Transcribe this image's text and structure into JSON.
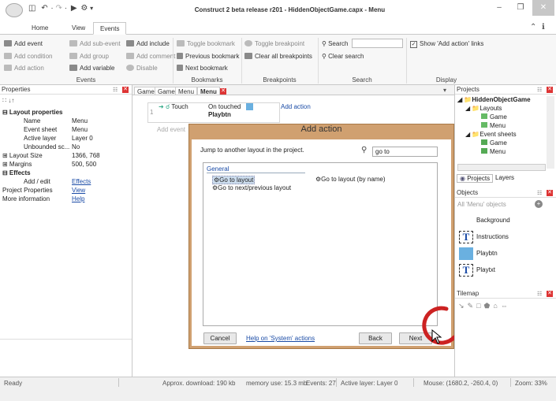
{
  "window": {
    "title": "Construct 2 beta release r201 - HiddenObjectGame.capx - Menu",
    "controls": {
      "minimize": "–",
      "restore": "❐",
      "close": "✕"
    }
  },
  "quick_access": {
    "icons": [
      "save-icon",
      "undo-icon",
      "redo-icon",
      "preview-icon",
      "debug-icon"
    ],
    "sep": "·",
    "arrow": "▾"
  },
  "menu_tabs": [
    "Home",
    "View",
    "Events"
  ],
  "ribbon_right_icons": {
    "collapse": "⌃",
    "help": "ℹ"
  },
  "ribbon": {
    "events": [
      "Add event",
      "Add sub-event",
      "Add include",
      "Add condition",
      "Add group",
      "Add comment",
      "Add action",
      "Add variable",
      "Disable"
    ],
    "bookmarks": [
      "Toggle bookmark",
      "Previous bookmark",
      "Next bookmark"
    ],
    "breakpoints": [
      "Toggle breakpoint",
      "Clear all breakpoints"
    ],
    "search": [
      "Search",
      "Clear search"
    ],
    "display": "Show 'Add action' links",
    "groups": [
      "Events",
      "Bookmarks",
      "Breakpoints",
      "Search",
      "Display"
    ]
  },
  "properties": {
    "title": "Properties",
    "toolbar": "∷ ↓↑",
    "rows": [
      {
        "k": "⊟ Layout properties",
        "v": "",
        "bold": true
      },
      {
        "k": "Name",
        "v": "Menu"
      },
      {
        "k": "Event sheet",
        "v": "Menu"
      },
      {
        "k": "Active layer",
        "v": "Layer 0"
      },
      {
        "k": "Unbounded sc...",
        "v": "No"
      },
      {
        "k": "⊞ Layout Size",
        "v": "1366, 768"
      },
      {
        "k": "⊞ Margins",
        "v": "500, 500"
      },
      {
        "k": "⊟ Effects",
        "v": "",
        "bold": true
      },
      {
        "k": "Add / edit",
        "v": "Effects",
        "link": true
      },
      {
        "k": "Project Properties",
        "v": "View",
        "link": true,
        "root": true
      },
      {
        "k": "More information",
        "v": "Help",
        "link": true,
        "root": true
      }
    ]
  },
  "doc_tabs": [
    "Game",
    "Game",
    "Menu",
    "Menu"
  ],
  "event": {
    "number": "1",
    "object": "Touch",
    "condition": "On touched",
    "target": "Playbtn",
    "add_action": "Add action",
    "add_event": "Add event"
  },
  "dialog": {
    "title": "Add action",
    "description": "Jump to another layout in the project.",
    "search_value": "go to",
    "category": "General",
    "items": [
      "Go to layout",
      "Go to next/previous layout",
      "Go to layout (by name)"
    ],
    "cancel": "Cancel",
    "help_link": "Help on 'System' actions",
    "back": "Back",
    "next": "Next"
  },
  "projects": {
    "title": "Projects",
    "root": "HiddenObjectGame",
    "layouts_folder": "Layouts",
    "layouts": [
      "Game",
      "Menu"
    ],
    "eventsheets_folder": "Event sheets",
    "eventsheets": [
      "Game",
      "Menu"
    ],
    "tabs": [
      "Projects",
      "Layers"
    ]
  },
  "objects": {
    "title": "Objects",
    "filter": "All 'Menu' objects",
    "items": [
      "Background",
      "Instructions",
      "Playbtn",
      "Playtxt"
    ]
  },
  "tilemap": {
    "title": "Tilemap",
    "tools": [
      "↘",
      "✎",
      "□",
      "⬟",
      "⌂",
      "⇔"
    ]
  },
  "status": {
    "ready": "Ready",
    "download": "Approx. download: 190 kb",
    "memory": "memory use: 15.3 mb",
    "events": "Events: 27",
    "layer": "Active layer: Layer 0",
    "mouse": "Mouse: (1680.2, -260.4, 0)",
    "zoom": "Zoom: 33%"
  },
  "colors": {
    "accent": "#d33a3a",
    "dialog_frame": "#d0a070",
    "link": "#1a4ba6",
    "highlight_circle": "#cc2222"
  }
}
